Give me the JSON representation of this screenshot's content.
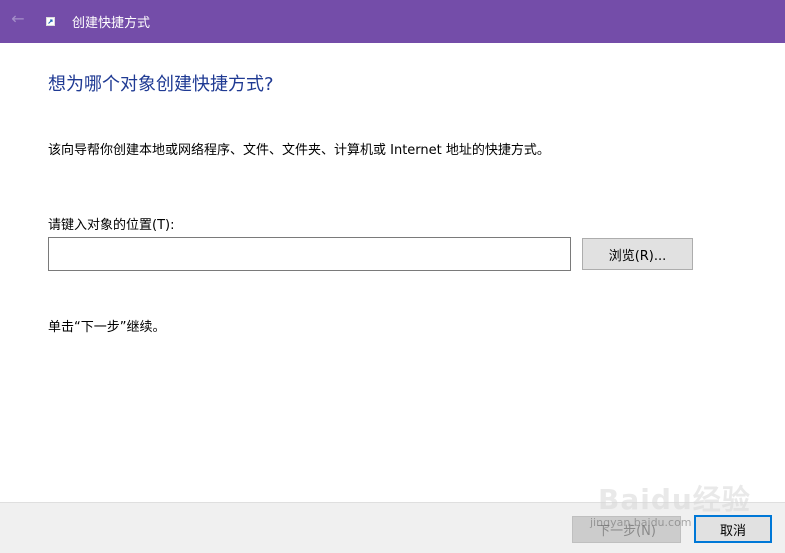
{
  "titlebar": {
    "title": "创建快捷方式",
    "back_icon": "arrow-left-icon",
    "app_icon": "shortcut-icon",
    "color": "#744da9"
  },
  "main": {
    "heading": "想为哪个对象创建快捷方式?",
    "heading_color": "#1f3a93",
    "description": "该向导帮你创建本地或网络程序、文件、文件夹、计算机或 Internet 地址的快捷方式。",
    "location_label": "请键入对象的位置(T):",
    "location_value": "",
    "browse_label": "浏览(R)...",
    "continue_hint": "单击“下一步”继续。"
  },
  "footer": {
    "next_label": "下一步(N)",
    "cancel_label": "取消"
  },
  "watermark": {
    "brand": "Baidu经验",
    "url": "jingyan.baidu.com"
  }
}
